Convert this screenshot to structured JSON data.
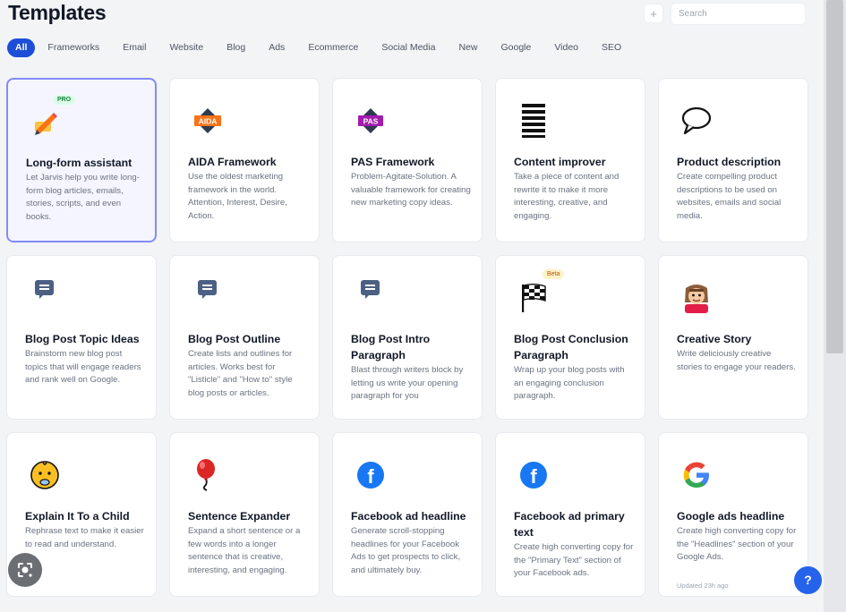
{
  "header": {
    "title": "Templates",
    "add_symbol": "+",
    "search_placeholder": "Search"
  },
  "filters": [
    "All",
    "Frameworks",
    "Email",
    "Website",
    "Blog",
    "Ads",
    "Ecommerce",
    "Social Media",
    "New",
    "Google",
    "Video",
    "SEO"
  ],
  "active_filter": "All",
  "colors": {
    "accent": "#1d4ed8",
    "selected_border": "#818cf8",
    "pro_badge": "#dcfce7",
    "beta_badge": "#fef3c7"
  },
  "cards": [
    {
      "title": "Long-form assistant",
      "desc": "Let Jarvis help you write long-form blog articles, emails, stories, scripts, and even books.",
      "icon": "pencil-writing-icon",
      "badge": "PRO"
    },
    {
      "title": "AIDA Framework",
      "desc": "Use the oldest marketing framework in the world. Attention, Interest, Desire, Action.",
      "icon": "aida-icon",
      "icon_text": "AIDA"
    },
    {
      "title": "PAS Framework",
      "desc": "Problem-Agitate-Solution. A valuable framework for creating new marketing copy ideas.",
      "icon": "pas-icon",
      "icon_text": "PAS"
    },
    {
      "title": "Content improver",
      "desc": "Take a piece of content and rewrite it to make it more interesting, creative, and engaging.",
      "icon": "lines-icon"
    },
    {
      "title": "Product description",
      "desc": "Create compelling product descriptions to be used on websites, emails and social media.",
      "icon": "speech-bubble-icon"
    },
    {
      "title": "Blog Post Topic Ideas",
      "desc": "Brainstorm new blog post topics that will engage readers and rank well on Google.",
      "icon": "chat-icon"
    },
    {
      "title": "Blog Post Outline",
      "desc": "Create lists and outlines for articles. Works best for \"Listicle\" and \"How to\" style blog posts or articles.",
      "icon": "chat-icon"
    },
    {
      "title": "Blog Post Intro Paragraph",
      "desc": "Blast through writers block by letting us write your opening paragraph for you",
      "icon": "chat-icon"
    },
    {
      "title": "Blog Post Conclusion Paragraph",
      "desc": "Wrap up your blog posts with an engaging conclusion paragraph.",
      "icon": "checkered-flag-icon",
      "badge": "Beta"
    },
    {
      "title": "Creative Story",
      "desc": "Write deliciously creative stories to engage your readers.",
      "icon": "storyteller-icon"
    },
    {
      "title": "Explain It To a Child",
      "desc": "Rephrase text to make it easier to read and understand.",
      "icon": "baby-icon"
    },
    {
      "title": "Sentence Expander",
      "desc": "Expand a short sentence or a few words into a longer sentence that is creative, interesting, and engaging.",
      "icon": "balloon-icon"
    },
    {
      "title": "Facebook ad headline",
      "desc": "Generate scroll-stopping headlines for your Facebook Ads to get prospects to click, and ultimately buy.",
      "icon": "facebook-icon"
    },
    {
      "title": "Facebook ad primary text",
      "desc": "Create high converting copy for the \"Primary Text\" section of your Facebook ads.",
      "icon": "facebook-icon"
    },
    {
      "title": "Google ads headline",
      "desc": "Create high converting copy for the \"Headlines\" section of your Google Ads.",
      "icon": "google-icon",
      "updated": "Updated 23h ago"
    }
  ],
  "help_label": "?"
}
